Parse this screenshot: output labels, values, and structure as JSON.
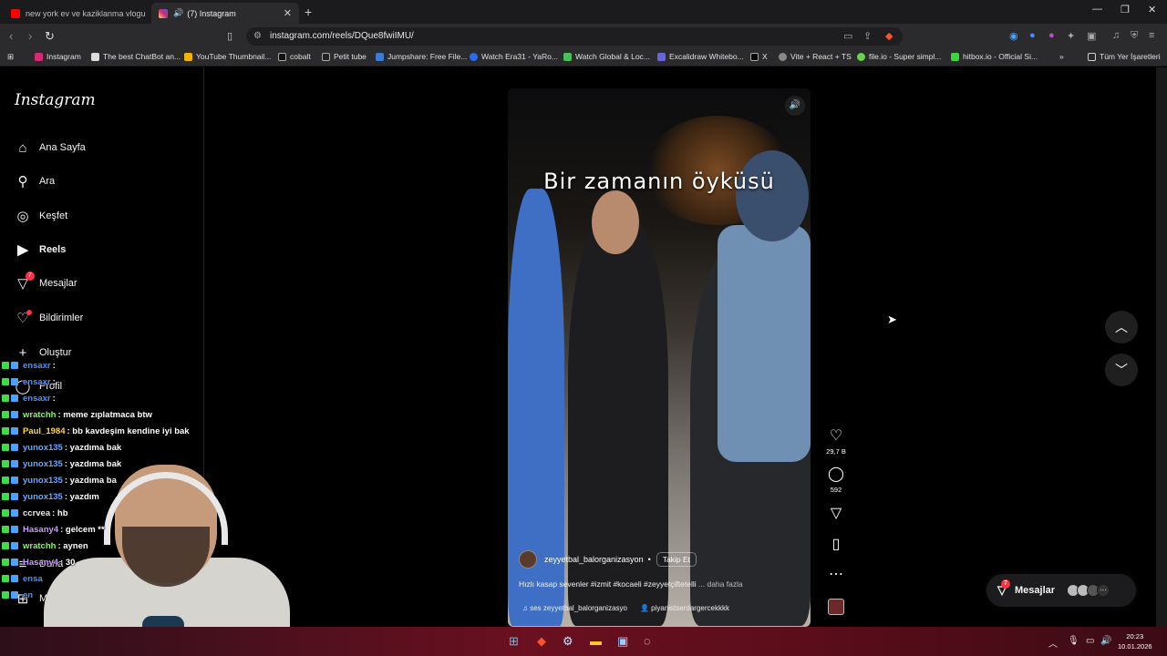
{
  "browser": {
    "tabs": [
      {
        "title": "new york ev ve kaziklanma vlogu - Yo",
        "active": false
      },
      {
        "title": "(7) Instagram",
        "active": true
      }
    ],
    "url": "instagram.com/reels/DQue8fwiIMU/",
    "bookmarks": [
      "Instagram",
      "The best ChatBot an...",
      "YouTube Thumbnail...",
      "cobalt",
      "Petit tube",
      "Jumpshare: Free File...",
      "Watch Era31 - YaRo...",
      "Watch Global & Loc...",
      "Excalidraw Whitebo...",
      "X",
      "Vite + React + TS",
      "file.io - Super simpl...",
      "hitbox.io - Official Si..."
    ],
    "all_bookmarks": "Tüm Yer İşaretleri"
  },
  "instagram": {
    "logo": "Instagram",
    "nav": [
      {
        "label": "Ana Sayfa",
        "icon": "home-icon"
      },
      {
        "label": "Ara",
        "icon": "search-icon"
      },
      {
        "label": "Keşfet",
        "icon": "compass-icon"
      },
      {
        "label": "Reels",
        "icon": "reels-icon"
      },
      {
        "label": "Mesajlar",
        "icon": "messenger-icon",
        "badge": "7"
      },
      {
        "label": "Bildirimler",
        "icon": "heart-icon"
      },
      {
        "label": "Oluştur",
        "icon": "plus-icon"
      },
      {
        "label": "Profil",
        "icon": "profile-icon"
      },
      {
        "label": "Daha",
        "icon": "menu-icon"
      },
      {
        "label": "Meta",
        "icon": "grid-icon"
      }
    ],
    "reel": {
      "overlay_text": "Bir zamanın öyküsü",
      "username": "zeyyetbal_balorganizasyon",
      "follow": "Takip Et",
      "caption": "Hızlı kasap sevenler #izmit #kocaeli #zeyyetçiftetelli",
      "more": "... daha fazla",
      "audio": "ses   zeyyetbal_balorganizasyo",
      "tagged": "piyanistserdargercekkkk",
      "likes": "29,7 B",
      "comments": "592"
    },
    "messages_pill": {
      "label": "Mesajlar",
      "badge": "7"
    }
  },
  "chat": [
    {
      "user": "ensaxr",
      "msg": ":",
      "color": "#4a90ff"
    },
    {
      "user": "ensaxr",
      "msg": ":",
      "color": "#4a90ff"
    },
    {
      "user": "ensaxr",
      "msg": ":",
      "color": "#4a90ff"
    },
    {
      "user": "wratchh",
      "msg": ": meme zıplatmaca btw",
      "color": "#7cff5a"
    },
    {
      "user": "Paul_1984",
      "msg": ": bb kavdeşim kendine iyi bak",
      "color": "#ffd54a"
    },
    {
      "user": "yunox135",
      "msg": ": yazdıma bak",
      "color": "#6aa7ff"
    },
    {
      "user": "yunox135",
      "msg": ": yazdıma bak",
      "color": "#6aa7ff"
    },
    {
      "user": "yunox135",
      "msg": ": yazdıma ba",
      "color": "#6aa7ff"
    },
    {
      "user": "yunox135",
      "msg": ": yazdım",
      "color": "#6aa7ff"
    },
    {
      "user": "ccrvea",
      "msg": ": hb",
      "color": "#e8e8e8"
    },
    {
      "user": "Hasany4",
      "msg": ": gelcem **",
      "color": "#c89bff"
    },
    {
      "user": "wratchh",
      "msg": ": aynen",
      "color": "#7cff5a"
    },
    {
      "user": "Hasany4",
      "msg": ": 30",
      "color": "#c89bff"
    },
    {
      "user": "ensa",
      "msg": "",
      "color": "#4a90ff"
    },
    {
      "user": "en",
      "msg": "",
      "color": "#4a90ff"
    }
  ],
  "clock": {
    "time": "20:23",
    "date": "10.01.2026"
  },
  "colors": {
    "accent": "#ff3040",
    "taskbar": "#6a1020"
  }
}
